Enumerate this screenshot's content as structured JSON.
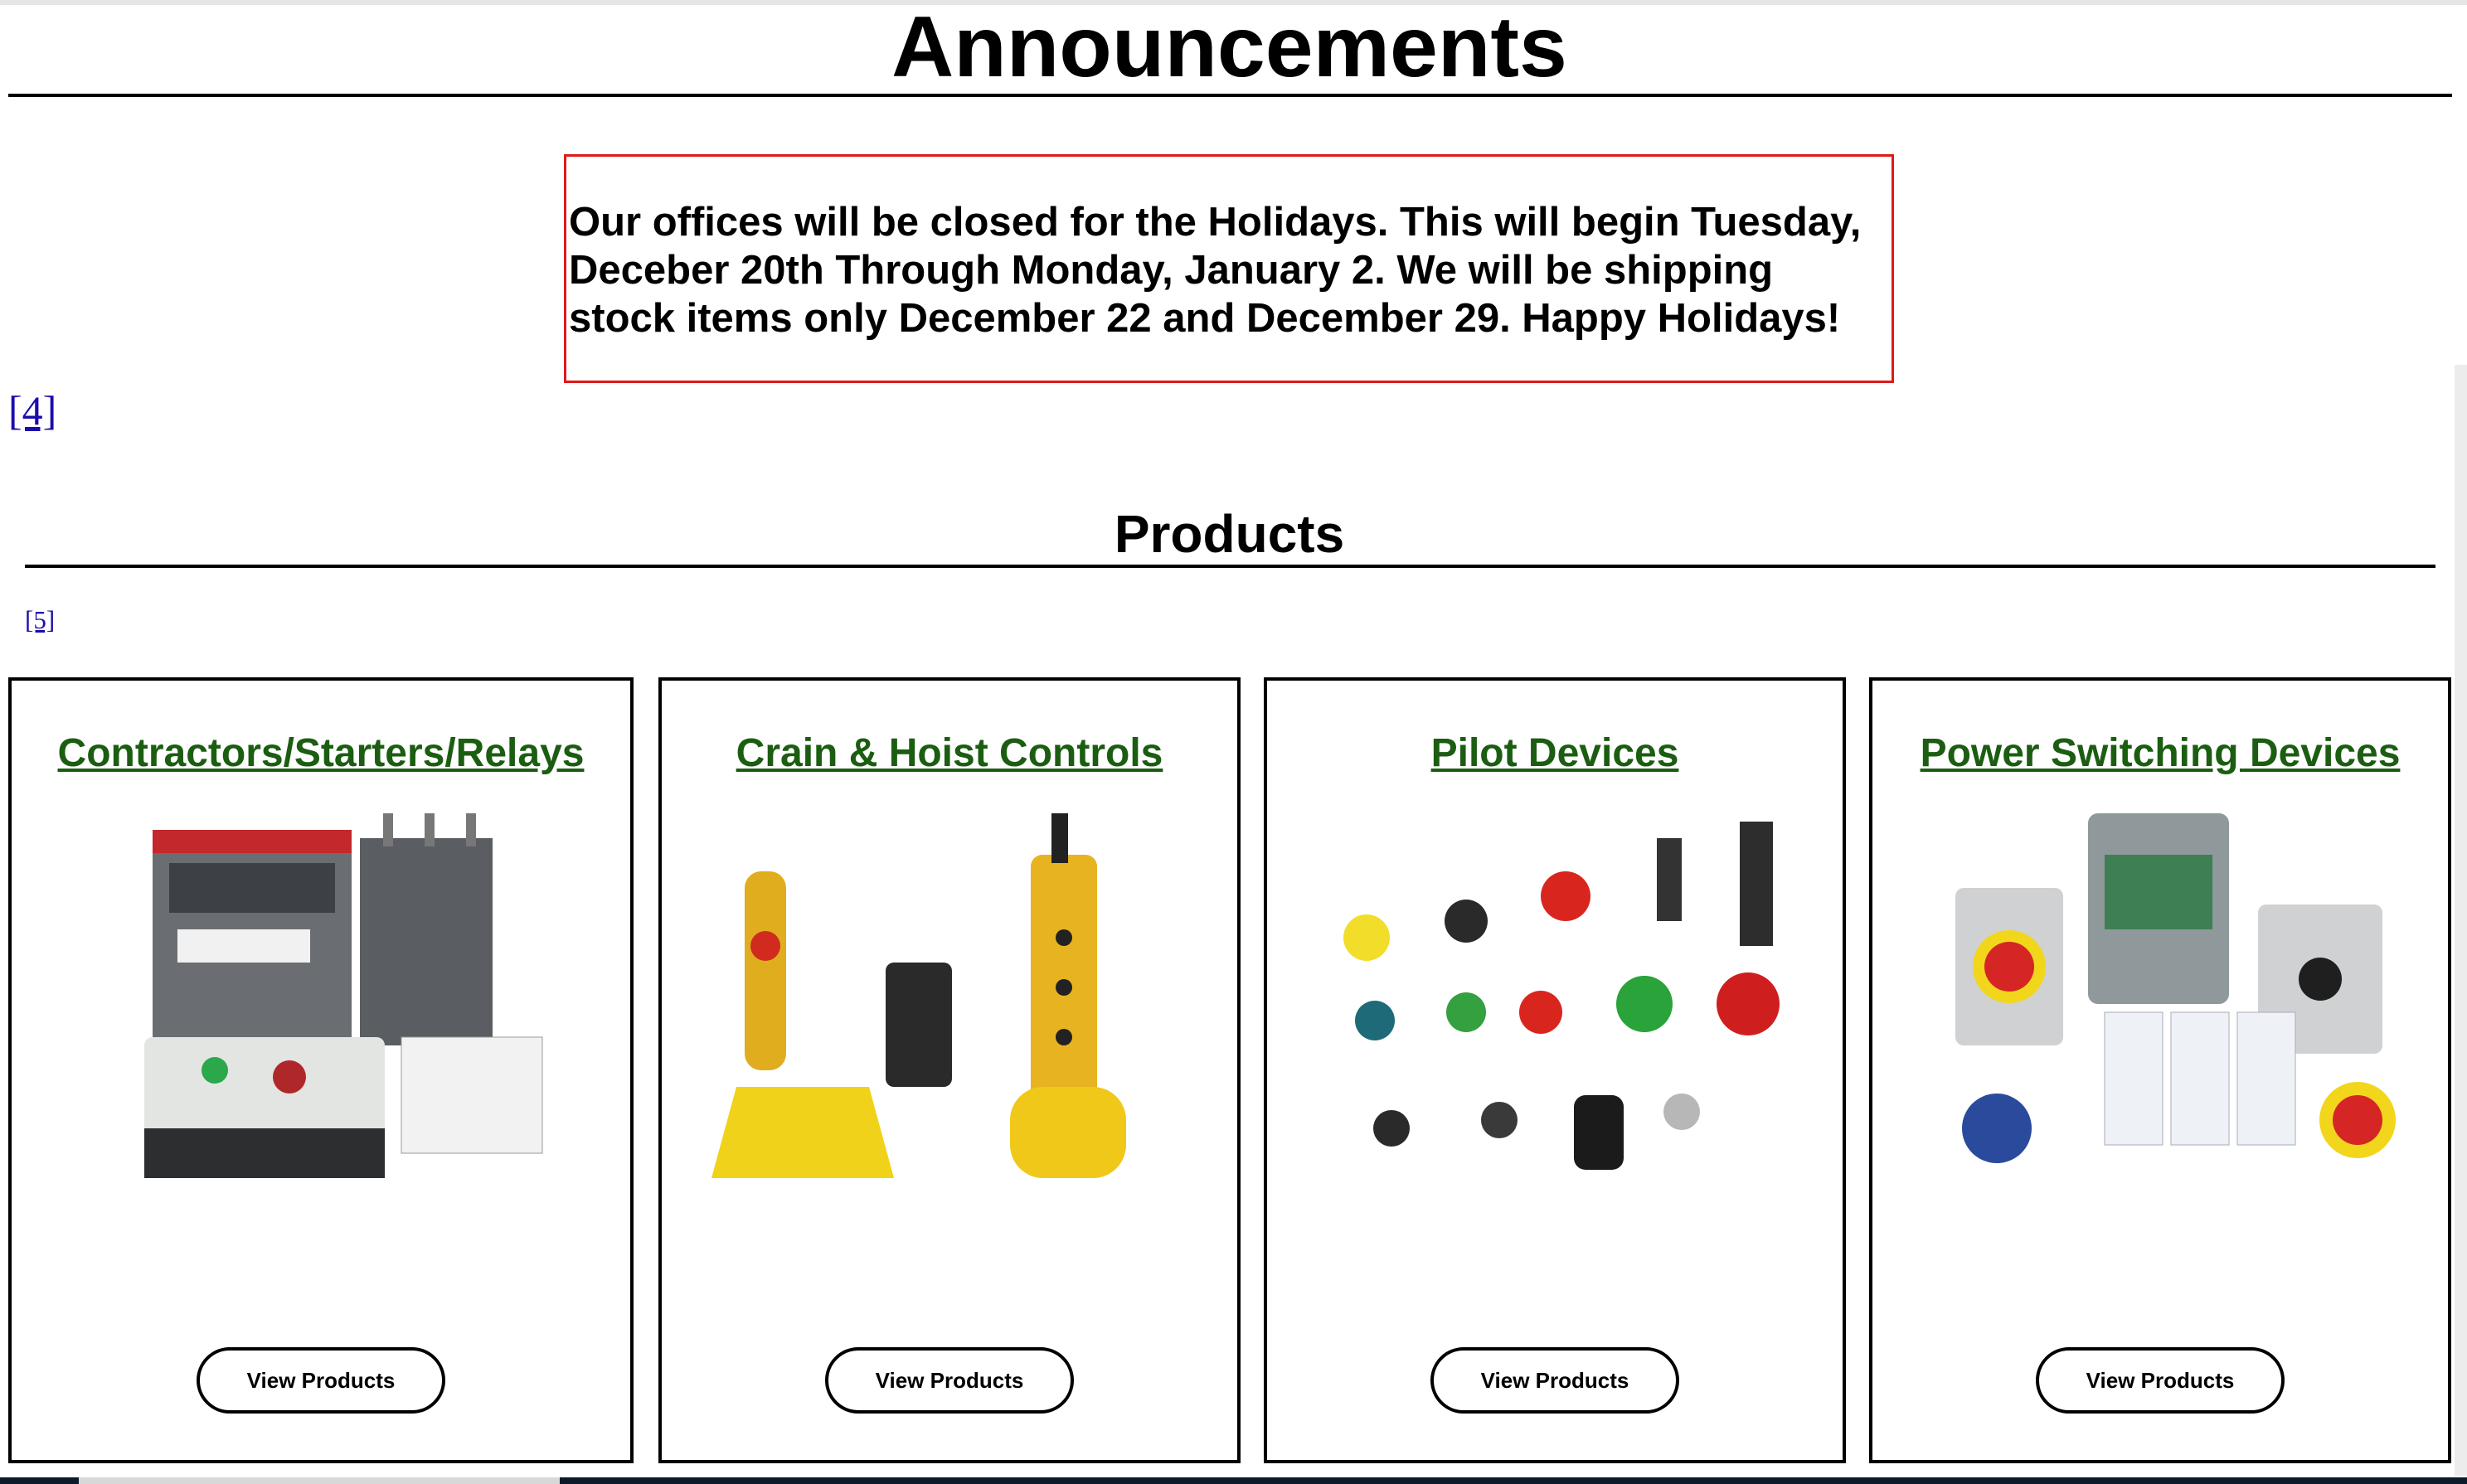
{
  "announcements": {
    "heading": "Announcements",
    "notice_lines": [
      "Our offices will be closed for the Holidays. This will begin Tuesday,",
      "Deceber 20th Through Monday, January 2. We will be shipping",
      "stock items only December 22 and December 29. Happy Holidays!"
    ],
    "ref_link": "[4]"
  },
  "products": {
    "heading": "Products",
    "ref_link": "[5]",
    "cards": [
      {
        "title": "Contractors/Starters/Relays",
        "button": "View Products",
        "image": "contactors-starters-relays-photo"
      },
      {
        "title": "Crain & Hoist Controls",
        "button": "View Products",
        "image": "crane-hoist-controls-photo"
      },
      {
        "title": "Pilot Devices",
        "button": "View Products",
        "image": "pilot-devices-photo"
      },
      {
        "title": "Power Switching Devices",
        "button": "View Products",
        "image": "power-switching-devices-photo"
      }
    ]
  },
  "colors": {
    "link_green": "#1b5d11",
    "notice_border": "#e01919",
    "ref_link_blue": "#1a0dab"
  }
}
